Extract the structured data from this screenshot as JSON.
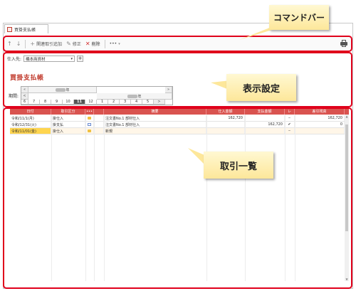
{
  "document_tab": {
    "label": "買掛支払帳"
  },
  "command_bar": {
    "buttons": [
      {
        "label": "関連取引追加"
      },
      {
        "label": "修正"
      },
      {
        "label": "削除"
      },
      {
        "label": "•••"
      }
    ]
  },
  "settings": {
    "supplier_label": "仕入先:",
    "supplier_value": "橋本商資材",
    "title": "買掛支払帳",
    "period_label": "期間:",
    "year_label_1": "年",
    "year_label_2": "年",
    "months": [
      "6",
      "7",
      "8",
      "9",
      "10",
      "11",
      "12",
      "1",
      "2",
      "3",
      "4",
      "5"
    ],
    "selected_month": "11",
    "nav_prev": "«",
    "nav_next": "»",
    "nav_prev2": "<",
    "nav_next2": ">"
  },
  "table": {
    "columns": [
      "日付",
      "取引区分",
      "•••",
      "",
      "摘要",
      "仕入金額",
      "支払金額",
      "レ",
      "差引残高"
    ],
    "rows": [
      {
        "date": "令和/11/1(月)",
        "type": "掛仕入",
        "icon": "folder-icon",
        "desc": "注文書No.1 部材仕入",
        "purchase": "162,720",
        "payment": "",
        "check": "‒",
        "balance": "162,720"
      },
      {
        "date": "令和/12/31(火)",
        "type": "掛支払",
        "icon": "message-icon",
        "desc": "注文書No.1 部材仕入",
        "purchase": "",
        "payment": "162,720",
        "check": "✔",
        "balance": "0"
      },
      {
        "date": "令和/11/01(金)",
        "type": "掛仕入",
        "icon": "folder-icon",
        "desc": "新規",
        "purchase": "",
        "payment": "",
        "check": "‒",
        "balance": ""
      }
    ]
  },
  "callouts": {
    "command_bar": "コマンドバー",
    "display_settings": "表示設定",
    "transaction_list": "取引一覧"
  },
  "colors": {
    "highlight": "#e0001b",
    "header": "#d9534f",
    "title": "#c0392b",
    "callout": "#fde79a"
  }
}
